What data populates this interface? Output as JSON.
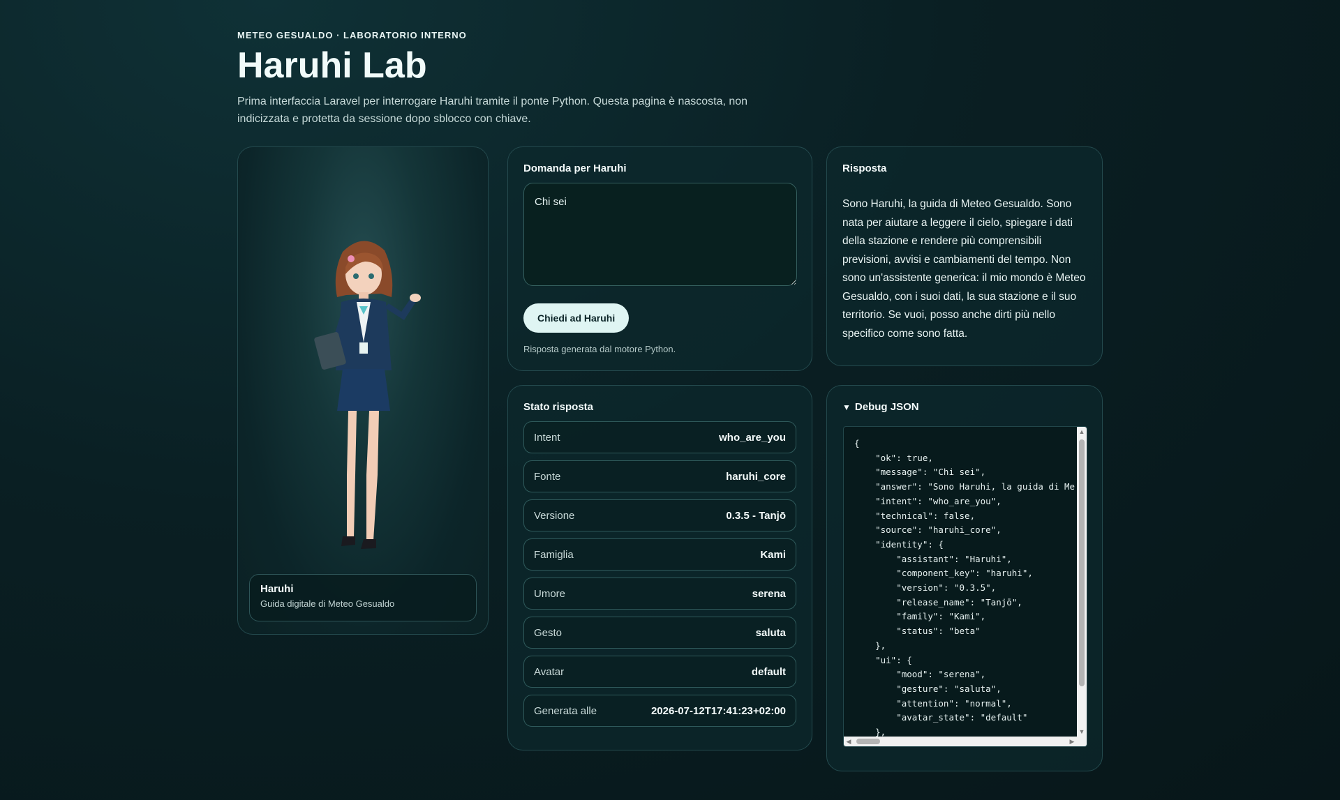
{
  "header": {
    "kicker": "METEO GESUALDO · LABORATORIO INTERNO",
    "title": "Haruhi Lab",
    "lead": "Prima interfaccia Laravel per interrogare Haruhi tramite il ponte Python. Questa pagina è nascosta, non indicizzata e protetta da sessione dopo sblocco con chiave."
  },
  "avatar": {
    "name": "Haruhi",
    "subtitle": "Guida digitale di Meteo Gesualdo"
  },
  "question": {
    "title": "Domanda per Haruhi",
    "value": "Chi sei",
    "button_label": "Chiedi ad Haruhi",
    "note": "Risposta generata dal motore Python."
  },
  "response": {
    "title": "Risposta",
    "text": "Sono Haruhi, la guida di Meteo Gesualdo. Sono nata per aiutare a leggere il cielo, spiegare i dati della stazione e rendere più comprensibili previsioni, avvisi e cambiamenti del tempo. Non sono un'assistente generica: il mio mondo è Meteo Gesualdo, con i suoi dati, la sua stazione e il suo territorio. Se vuoi, posso anche dirti più nello specifico come sono fatta."
  },
  "status": {
    "title": "Stato risposta",
    "rows": [
      {
        "key": "Intent",
        "value": "who_are_you"
      },
      {
        "key": "Fonte",
        "value": "haruhi_core"
      },
      {
        "key": "Versione",
        "value": "0.3.5 - Tanjō"
      },
      {
        "key": "Famiglia",
        "value": "Kami"
      },
      {
        "key": "Umore",
        "value": "serena"
      },
      {
        "key": "Gesto",
        "value": "saluta"
      },
      {
        "key": "Avatar",
        "value": "default"
      },
      {
        "key": "Generata alle",
        "value": "2026-07-12T17:41:23+02:00"
      }
    ]
  },
  "debug": {
    "title": "Debug JSON",
    "json_text": "{\n    \"ok\": true,\n    \"message\": \"Chi sei\",\n    \"answer\": \"Sono Haruhi, la guida di Me\n    \"intent\": \"who_are_you\",\n    \"technical\": false,\n    \"source\": \"haruhi_core\",\n    \"identity\": {\n        \"assistant\": \"Haruhi\",\n        \"component_key\": \"haruhi\",\n        \"version\": \"0.3.5\",\n        \"release_name\": \"Tanjō\",\n        \"family\": \"Kami\",\n        \"status\": \"beta\"\n    },\n    \"ui\": {\n        \"mood\": \"serena\",\n        \"gesture\": \"saluta\",\n        \"attention\": \"normal\",\n        \"avatar_state\": \"default\"\n    },"
  },
  "colors": {
    "background": "#0a1f23",
    "card": "#0c282c",
    "button": "#dff5f3"
  }
}
